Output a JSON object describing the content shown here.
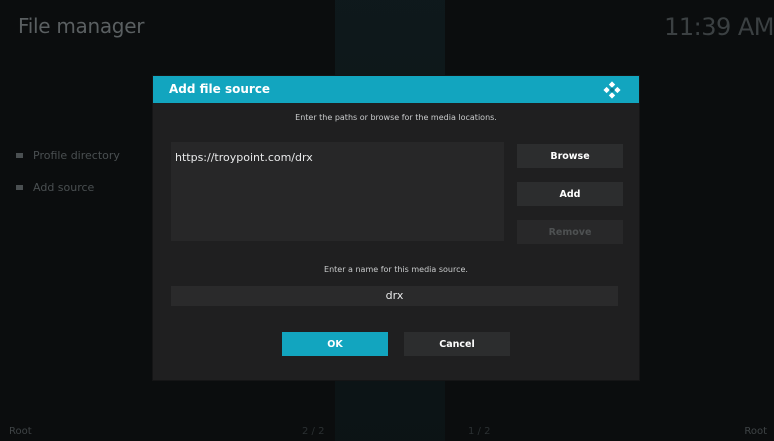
{
  "app": {
    "title": "File manager",
    "clock": "11:39 AM"
  },
  "sidebar": {
    "items": [
      {
        "label": "Profile directory",
        "icon": "folder-bullet-icon"
      },
      {
        "label": "Add source",
        "icon": "folder-bullet-icon"
      }
    ]
  },
  "footer": {
    "left_label": "Root",
    "right_label": "Root",
    "page_left": "2 / 2",
    "page_right": "1 / 2"
  },
  "dialog": {
    "title": "Add file source",
    "logo_icon": "kodi-logo-icon",
    "paths_instruction": "Enter the paths or browse for the media locations.",
    "paths": [
      "https://troypoint.com/drx"
    ],
    "buttons": {
      "browse": "Browse",
      "add": "Add",
      "remove": "Remove"
    },
    "name_instruction": "Enter a name for this media source.",
    "name_value": "drx",
    "ok_label": "OK",
    "cancel_label": "Cancel"
  },
  "colors": {
    "accent": "#12a5bf",
    "dialog_bg": "#1f1f20",
    "background": "#0b0d0e"
  }
}
